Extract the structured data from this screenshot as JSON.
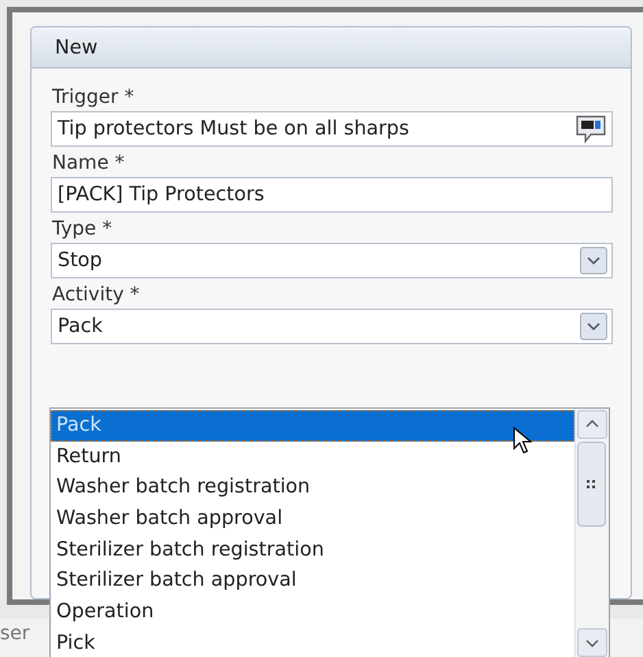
{
  "panel": {
    "title": "New"
  },
  "fields": [
    {
      "label": "Trigger *",
      "value": "Tip protectors Must be on all sharps",
      "kind": "text-with-help"
    },
    {
      "label": "Name *",
      "value": "[PACK] Tip Protectors",
      "kind": "text"
    },
    {
      "label": "Type *",
      "value": "Stop",
      "kind": "select"
    },
    {
      "label": "Activity *",
      "value": "Pack",
      "kind": "select"
    }
  ],
  "dropdown": {
    "items": [
      {
        "label": "Pack",
        "selected": true
      },
      {
        "label": "Return",
        "selected": false
      },
      {
        "label": "Washer batch registration",
        "selected": false
      },
      {
        "label": "Washer batch approval",
        "selected": false
      },
      {
        "label": "Sterilizer batch registration",
        "selected": false
      },
      {
        "label": "Sterilizer batch approval",
        "selected": false
      },
      {
        "label": "Operation",
        "selected": false
      },
      {
        "label": "Pick",
        "selected": false
      }
    ]
  },
  "footer_text": "ser"
}
